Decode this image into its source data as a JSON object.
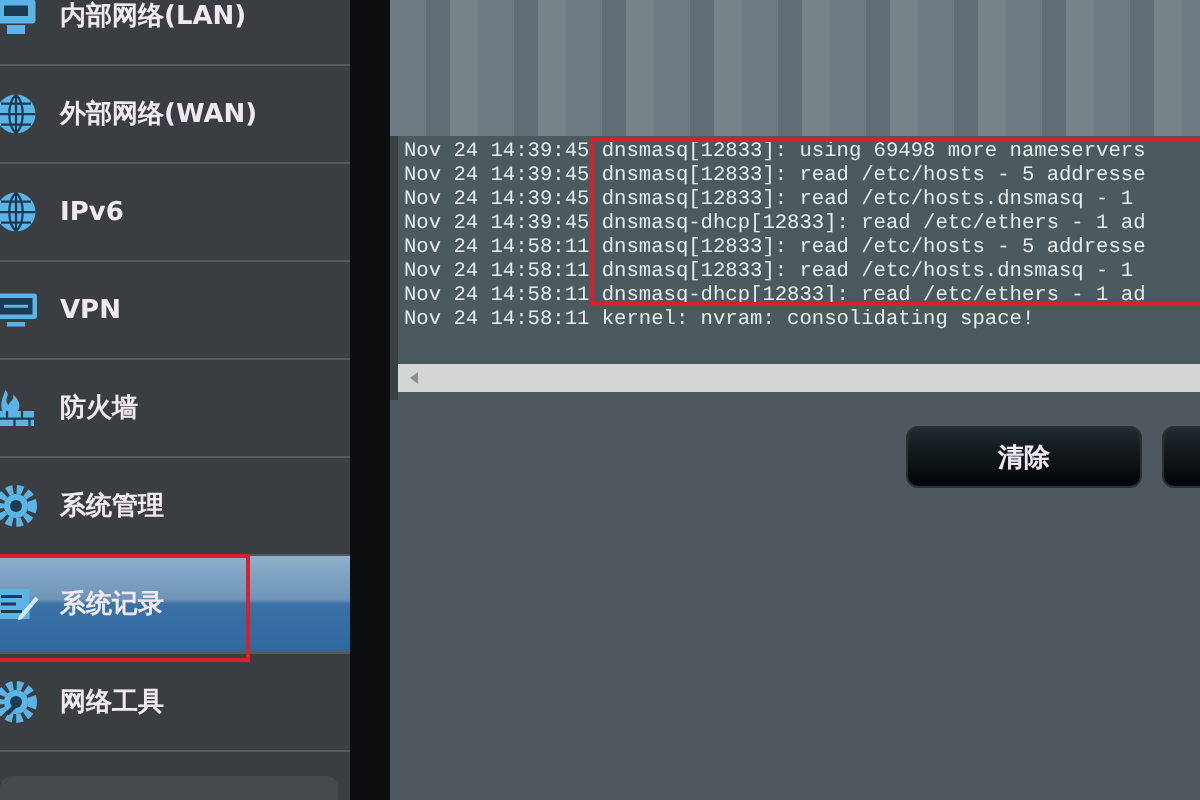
{
  "sidebar": {
    "items": [
      {
        "label": "内部网络(LAN)",
        "selected": false
      },
      {
        "label": "外部网络(WAN)",
        "selected": false
      },
      {
        "label": "IPv6",
        "selected": false
      },
      {
        "label": "VPN",
        "selected": false
      },
      {
        "label": "防火墙",
        "selected": false
      },
      {
        "label": "系统管理",
        "selected": false
      },
      {
        "label": "系统记录",
        "selected": true
      },
      {
        "label": "网络工具",
        "selected": false
      }
    ]
  },
  "log": {
    "lines": [
      "Nov 24 14:39:45 dnsmasq[12833]: using 69498 more nameservers",
      "Nov 24 14:39:45 dnsmasq[12833]: read /etc/hosts - 5 addresse",
      "Nov 24 14:39:45 dnsmasq[12833]: read /etc/hosts.dnsmasq - 1",
      "Nov 24 14:39:45 dnsmasq-dhcp[12833]: read /etc/ethers - 1 ad",
      "Nov 24 14:58:11 dnsmasq[12833]: read /etc/hosts - 5 addresse",
      "Nov 24 14:58:11 dnsmasq[12833]: read /etc/hosts.dnsmasq - 1",
      "Nov 24 14:58:11 dnsmasq-dhcp[12833]: read /etc/ethers - 1 ad",
      "Nov 24 14:58:11 kernel: nvram: consolidating space!"
    ]
  },
  "buttons": [
    "清除"
  ]
}
